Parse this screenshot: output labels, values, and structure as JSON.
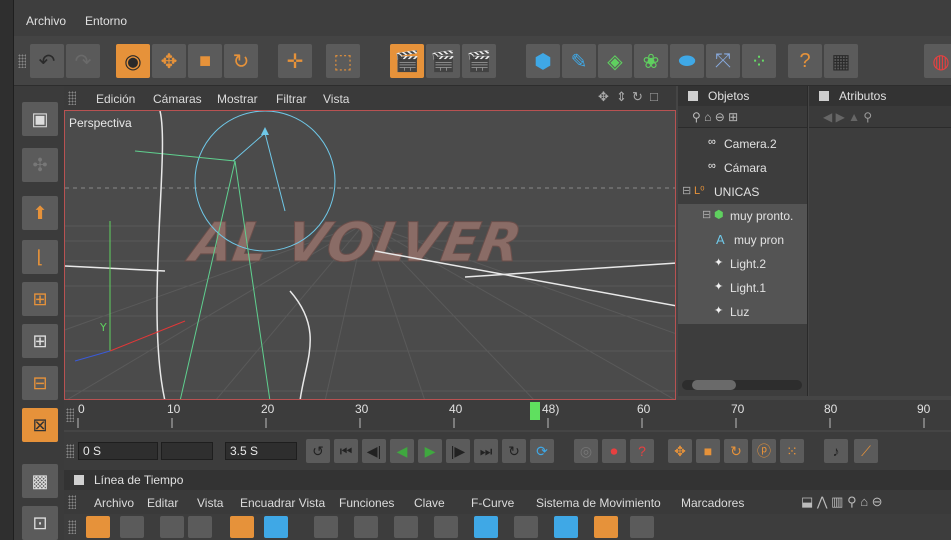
{
  "menubar": {
    "items": [
      "Archivo",
      "Entorno"
    ]
  },
  "viewport": {
    "menu": [
      "Edición",
      "Cámaras",
      "Mostrar",
      "Filtrar",
      "Vista"
    ],
    "label": "Perspectiva",
    "scene_text": "AL VOLVER"
  },
  "objects_panel": {
    "title": "Objetos",
    "items": [
      {
        "label": "Camera.2",
        "icon": "camera-icon"
      },
      {
        "label": "Cámara",
        "icon": "camera-icon"
      },
      {
        "label": "UNICAS",
        "icon": "null-group-icon"
      },
      {
        "label": "muy pronto.",
        "icon": "extrude-icon"
      },
      {
        "label": "muy pron",
        "icon": "text-spline-icon"
      },
      {
        "label": "Light.2",
        "icon": "light-icon"
      },
      {
        "label": "Light.1",
        "icon": "light-icon"
      },
      {
        "label": "Luz",
        "icon": "light-icon"
      }
    ]
  },
  "attributes_panel": {
    "title": "Atributos"
  },
  "ruler": {
    "ticks": [
      "0",
      "10",
      "20",
      "30",
      "40",
      "60",
      "70",
      "80",
      "90"
    ],
    "current_frame": "48)"
  },
  "transport": {
    "start_time": "0 S",
    "end_time": "3.5 S"
  },
  "timeline": {
    "title": "Línea de Tiempo",
    "menu": [
      "Archivo",
      "Editar",
      "Vista",
      "Encuadrar Vista",
      "Funciones",
      "Clave",
      "F-Curve",
      "Sistema de Movimiento",
      "Marcadores"
    ]
  },
  "colors": {
    "accent": "#e6923a",
    "selection_border": "#b85252",
    "playhead": "#5fe05f",
    "spline": "#6fc8e8"
  }
}
